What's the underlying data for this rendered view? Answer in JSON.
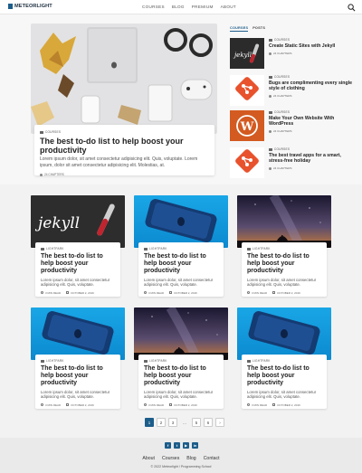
{
  "header": {
    "logo": "METEORLIGHT",
    "nav": [
      "COURSES",
      "BLOG",
      "PREMIUM",
      "ABOUT"
    ]
  },
  "hero": {
    "tag": "COURSES",
    "title": "The best to-do list to help boost your productivity",
    "excerpt": "Lorem ipsum dolor, sit amet consectetur adipisicing elit. Quis, voluptate. Lorem ipsum, dolor sit amet consectetur adipisicing elit. Molestias, at.",
    "meta": "24 CHAPTERS"
  },
  "sidebar": {
    "tabs": [
      "COURSES",
      "POSTS"
    ],
    "items": [
      {
        "tag": "COURSES",
        "title": "Create Static Sites with Jekyll",
        "meta": "24 CHAPTERS",
        "icon": "jekyll-icon"
      },
      {
        "tag": "COURSES",
        "title": "Bugs are complimenting every single style of clothing",
        "meta": "24 CHAPTERS",
        "icon": "git-icon"
      },
      {
        "tag": "COURSES",
        "title": "Make Your Own Website With WordPress",
        "meta": "24 CHAPTERS",
        "icon": "wordpress-icon"
      },
      {
        "tag": "COURSES",
        "title": "The best travel apps for a smart, stress-free holiday",
        "meta": "24 CHAPTERS",
        "icon": "git-icon"
      }
    ]
  },
  "cards": [
    {
      "tag": "LIGHTPARK",
      "title": "The best to-do list to help boost your productivity",
      "excerpt": "Lorem ipsum dolor, sit amet consectetur adipisicing elit. Quis, voluptate.",
      "read": "3 MIN READ",
      "date": "OCTOBER 2, 2016"
    },
    {
      "tag": "LIGHTPARK",
      "title": "The best to-do list to help boost your productivity",
      "excerpt": "Lorem ipsum dolor, sit amet consectetur adipisicing elit. Quis, voluptate.",
      "read": "3 MIN READ",
      "date": "OCTOBER 2, 2016"
    },
    {
      "tag": "LIGHTPARK",
      "title": "The best to-do list to help boost your productivity",
      "excerpt": "Lorem ipsum dolor, sit amet consectetur adipisicing elit. Quis, voluptate.",
      "read": "3 MIN READ",
      "date": "OCTOBER 2, 2016"
    },
    {
      "tag": "LIGHTPARK",
      "title": "The best to-do list to help boost your productivity",
      "excerpt": "Lorem ipsum dolor, sit amet consectetur adipisicing elit. Quis, voluptate.",
      "read": "3 MIN READ",
      "date": "OCTOBER 2, 2016"
    },
    {
      "tag": "LIGHTPARK",
      "title": "The best to-do list to help boost your productivity",
      "excerpt": "Lorem ipsum dolor, sit amet consectetur adipisicing elit. Quis, voluptate.",
      "read": "3 MIN READ",
      "date": "OCTOBER 2, 2016"
    },
    {
      "tag": "LIGHTPARK",
      "title": "The best to-do list to help boost your productivity",
      "excerpt": "Lorem ipsum dolor, sit amet consectetur adipisicing elit. Quis, voluptate.",
      "read": "3 MIN READ",
      "date": "OCTOBER 2, 2016"
    }
  ],
  "pagination": [
    "1",
    "2",
    "3",
    "...",
    "5",
    "6",
    "›"
  ],
  "footer": {
    "social": [
      "f",
      "t",
      "▶",
      "in"
    ],
    "links": [
      "About",
      "Courses",
      "Blog",
      "Contact"
    ],
    "copyright": "© 2022 Meteorlight / Programming School"
  },
  "colors": {
    "accent": "#1c5d8a",
    "git": "#e8522c",
    "wordpress": "#d35a20"
  }
}
